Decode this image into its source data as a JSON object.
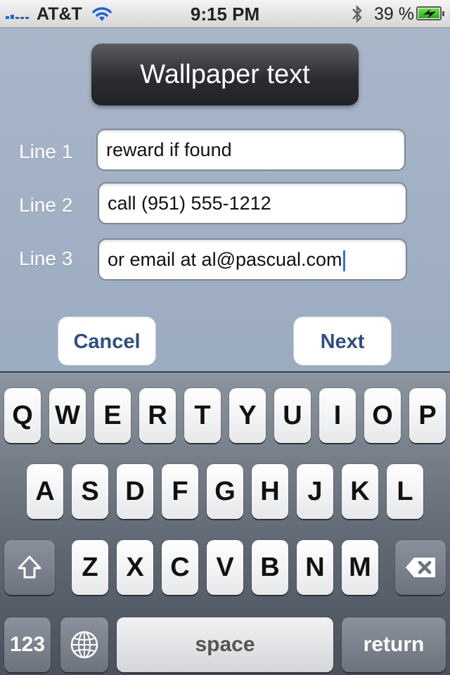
{
  "status_bar": {
    "carrier": "AT&T",
    "time": "9:15 PM",
    "battery": "39 %",
    "wifi_icon": "wifi-icon",
    "bluetooth_icon": "bluetooth-icon"
  },
  "title": "Wallpaper text",
  "lines": [
    {
      "label": "Line 1",
      "value": "reward if found"
    },
    {
      "label": "Line 2",
      "value": "call (951) 555-1212"
    },
    {
      "label": "Line 3",
      "value": "or email at al@pascual.com"
    }
  ],
  "buttons": {
    "cancel": "Cancel",
    "next": "Next"
  },
  "keyboard": {
    "row1": [
      "Q",
      "W",
      "E",
      "R",
      "T",
      "Y",
      "U",
      "I",
      "O",
      "P"
    ],
    "row2": [
      "A",
      "S",
      "D",
      "F",
      "G",
      "H",
      "J",
      "K",
      "L"
    ],
    "row3": [
      "Z",
      "X",
      "C",
      "V",
      "B",
      "N",
      "M"
    ],
    "numbers": "123",
    "space": "space",
    "return": "return"
  },
  "colors": {
    "accent": "#2f4f80",
    "background": "#a5b1c4",
    "title_bg": "#2b2d31"
  }
}
